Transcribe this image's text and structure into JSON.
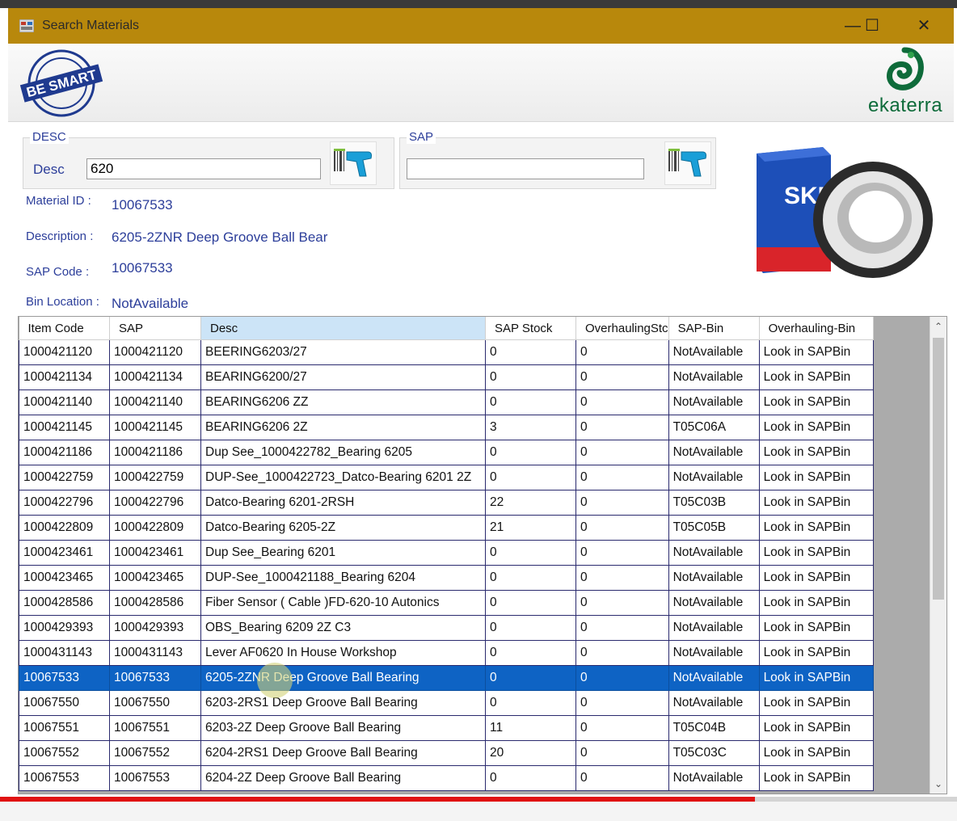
{
  "window": {
    "title": "Search Materials",
    "minimize": "—",
    "maximize": "☐",
    "close": "✕"
  },
  "branding": {
    "stamp_text": "BE SMART",
    "company": "ekaterra",
    "product_brand": "SKF"
  },
  "desc_group": {
    "legend": "DESC",
    "label": "Desc",
    "value": "620"
  },
  "sap_group": {
    "legend": "SAP",
    "value": ""
  },
  "details": {
    "material_id_label": "Material ID :",
    "material_id": "10067533",
    "description_label": "Description :",
    "description": "6205-2ZNR Deep Groove Ball Bear",
    "sap_code_label": "SAP Code :",
    "sap_code": "10067533",
    "bin_location_label": "Bin Location :",
    "bin_location": "NotAvailable"
  },
  "grid": {
    "columns": [
      "Item Code",
      "SAP",
      "Desc",
      "SAP Stock",
      "OverhaulingStc",
      "SAP-Bin",
      "Overhauling-Bin"
    ],
    "sorted_column": 2,
    "selected_row": 13,
    "rows": [
      [
        "1000421120",
        "1000421120",
        "BEERING6203/27",
        "0",
        "0",
        "NotAvailable",
        "Look in SAPBin"
      ],
      [
        "1000421134",
        "1000421134",
        "BEARING6200/27",
        "0",
        "0",
        "NotAvailable",
        "Look in SAPBin"
      ],
      [
        "1000421140",
        "1000421140",
        "BEARING6206 ZZ",
        "0",
        "0",
        "NotAvailable",
        "Look in SAPBin"
      ],
      [
        "1000421145",
        "1000421145",
        "BEARING6206 2Z",
        "3",
        "0",
        "T05C06A",
        "Look in SAPBin"
      ],
      [
        "1000421186",
        "1000421186",
        "Dup See_1000422782_Bearing 6205",
        "0",
        "0",
        "NotAvailable",
        "Look in SAPBin"
      ],
      [
        "1000422759",
        "1000422759",
        "DUP-See_1000422723_Datco-Bearing 6201 2Z",
        "0",
        "0",
        "NotAvailable",
        "Look in SAPBin"
      ],
      [
        "1000422796",
        "1000422796",
        "Datco-Bearing 6201-2RSH",
        "22",
        "0",
        "T05C03B",
        "Look in SAPBin"
      ],
      [
        "1000422809",
        "1000422809",
        "Datco-Bearing 6205-2Z",
        "21",
        "0",
        "T05C05B",
        "Look in SAPBin"
      ],
      [
        "1000423461",
        "1000423461",
        "Dup See_Bearing 6201",
        "0",
        "0",
        "NotAvailable",
        "Look in SAPBin"
      ],
      [
        "1000423465",
        "1000423465",
        "DUP-See_1000421188_Bearing 6204",
        "0",
        "0",
        "NotAvailable",
        "Look in SAPBin"
      ],
      [
        "1000428586",
        "1000428586",
        "Fiber Sensor ( Cable )FD-620-10 Autonics",
        "0",
        "0",
        "NotAvailable",
        "Look in SAPBin"
      ],
      [
        "1000429393",
        "1000429393",
        "OBS_Bearing 6209 2Z C3",
        "0",
        "0",
        "NotAvailable",
        "Look in SAPBin"
      ],
      [
        "1000431143",
        "1000431143",
        "Lever AF0620  In House Workshop",
        "0",
        "0",
        "NotAvailable",
        "Look in SAPBin"
      ],
      [
        "10067533",
        "10067533",
        "6205-2ZNR Deep Groove Ball Bearing",
        "0",
        "0",
        "NotAvailable",
        "Look in SAPBin"
      ],
      [
        "10067550",
        "10067550",
        "6203-2RS1 Deep Groove Ball Bearing",
        "0",
        "0",
        "NotAvailable",
        "Look in SAPBin"
      ],
      [
        "10067551",
        "10067551",
        "6203-2Z Deep Groove Ball Bearing",
        "11",
        "0",
        "T05C04B",
        "Look in SAPBin"
      ],
      [
        "10067552",
        "10067552",
        "6204-2RS1 Deep Groove Ball Bearing",
        "20",
        "0",
        "T05C03C",
        "Look in SAPBin"
      ],
      [
        "10067553",
        "10067553",
        "6204-2Z Deep Groove Ball Bearing",
        "0",
        "0",
        "NotAvailable",
        "Look in SAPBin"
      ]
    ]
  },
  "colors": {
    "title_bar": "#b8880c",
    "label_blue": "#2c3e9a",
    "selection": "#0e63c4",
    "sorted_header": "#cce4f7",
    "progress_red": "#e01212"
  },
  "icons": [
    "app-icon",
    "barcode-scanner-icon",
    "ekaterra-leaf-icon",
    "scroll-up-icon",
    "scroll-down-icon"
  ]
}
